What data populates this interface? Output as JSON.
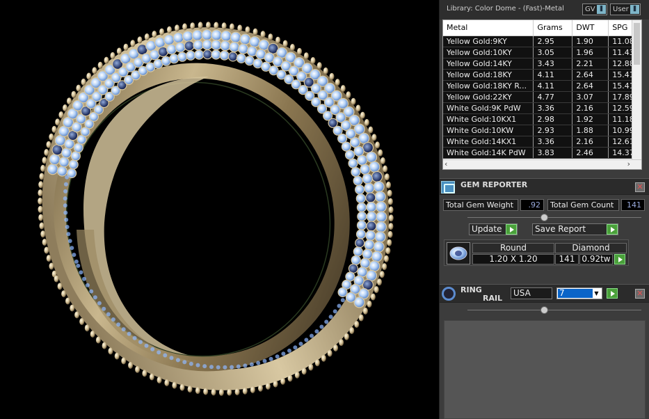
{
  "library": {
    "title": "Library: Color Dome - (Fast)-Metal",
    "gv_label": "GV",
    "user_label": "User",
    "columns": [
      "Metal",
      "Grams",
      "DWT",
      "SPG"
    ],
    "rows": [
      [
        "Yellow Gold:9KY",
        "2.95",
        "1.90",
        "11.08"
      ],
      [
        "Yellow Gold:10KY",
        "3.05",
        "1.96",
        "11.43"
      ],
      [
        "Yellow Gold:14KY",
        "3.43",
        "2.21",
        "12.88"
      ],
      [
        "Yellow Gold:18KY",
        "4.11",
        "2.64",
        "15.41"
      ],
      [
        "Yellow Gold:18KY R...",
        "4.11",
        "2.64",
        "15.41"
      ],
      [
        "Yellow Gold:22KY",
        "4.77",
        "3.07",
        "17.89"
      ],
      [
        "White Gold:9K PdW",
        "3.36",
        "2.16",
        "12.59"
      ],
      [
        "White Gold:10KX1",
        "2.98",
        "1.92",
        "11.18"
      ],
      [
        "White Gold:10KW",
        "2.93",
        "1.88",
        "10.99"
      ],
      [
        "White Gold:14KX1",
        "3.36",
        "2.16",
        "12.61"
      ],
      [
        "White Gold:14K PdW",
        "3.83",
        "2.46",
        "14.37"
      ]
    ]
  },
  "gem_reporter": {
    "title": "GEM REPORTER",
    "total_weight_label": "Total Gem Weight",
    "total_weight_value": ".92",
    "total_count_label": "Total Gem Count",
    "total_count_value": "141",
    "update_label": "Update",
    "save_report_label": "Save Report",
    "gem": {
      "shape": "Round",
      "material": "Diamond",
      "size": "1.20 X 1.20",
      "count": "141",
      "weight": "0.92tw"
    }
  },
  "ring_rail": {
    "title_line1": "RING",
    "title_line2": "RAIL",
    "region": "USA",
    "size": "7"
  }
}
